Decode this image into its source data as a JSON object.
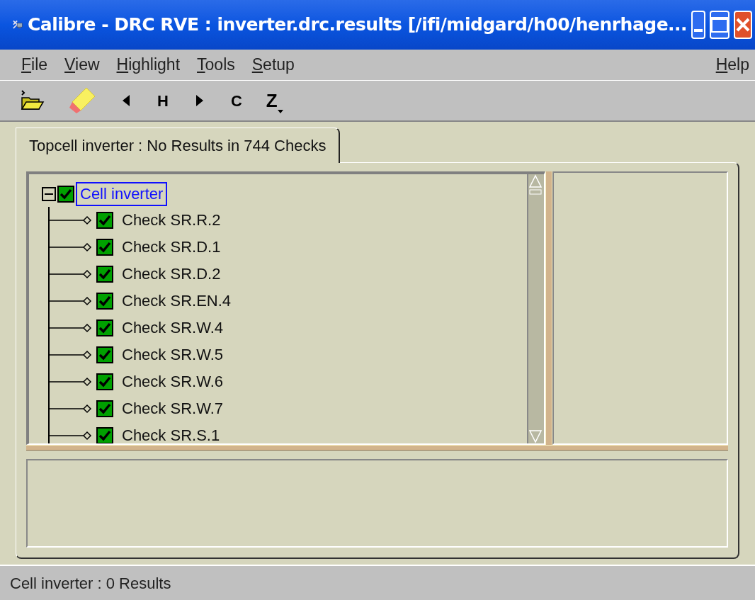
{
  "window": {
    "title": "Calibre - DRC RVE : inverter.drc.results [/ifi/midgard/h00/henrhage..."
  },
  "menu": [
    {
      "label": "File"
    },
    {
      "label": "View"
    },
    {
      "label": "Highlight"
    },
    {
      "label": "Tools"
    },
    {
      "label": "Setup"
    }
  ],
  "help_menu": {
    "label": "Help"
  },
  "toolbar": [
    {
      "kind": "open"
    },
    {
      "kind": "highlight"
    },
    {
      "kind": "prev"
    },
    {
      "kind": "text",
      "label": "H"
    },
    {
      "kind": "next"
    },
    {
      "kind": "text",
      "label": "C"
    },
    {
      "kind": "dropdown",
      "label": "Z"
    }
  ],
  "tabs": [
    {
      "label": "Topcell inverter : No Results in 744 Checks",
      "selected": true
    }
  ],
  "tree": [
    {
      "label": "Cell inverter",
      "checked": true,
      "selected": true,
      "expanded": true,
      "children": [
        {
          "label": "Check SR.R.2",
          "checked": true,
          "selected": false
        },
        {
          "label": "Check SR.D.1",
          "checked": true,
          "selected": false
        },
        {
          "label": "Check SR.D.2",
          "checked": true,
          "selected": false
        },
        {
          "label": "Check SR.EN.4",
          "checked": true,
          "selected": false
        },
        {
          "label": "Check SR.W.4",
          "checked": true,
          "selected": false
        },
        {
          "label": "Check SR.W.5",
          "checked": true,
          "selected": false
        },
        {
          "label": "Check SR.W.6",
          "checked": true,
          "selected": false
        },
        {
          "label": "Check SR.W.7",
          "checked": true,
          "selected": false
        },
        {
          "label": "Check SR.S.1",
          "checked": true,
          "selected": false
        }
      ]
    }
  ],
  "status_bar": "Cell inverter : 0 Results"
}
